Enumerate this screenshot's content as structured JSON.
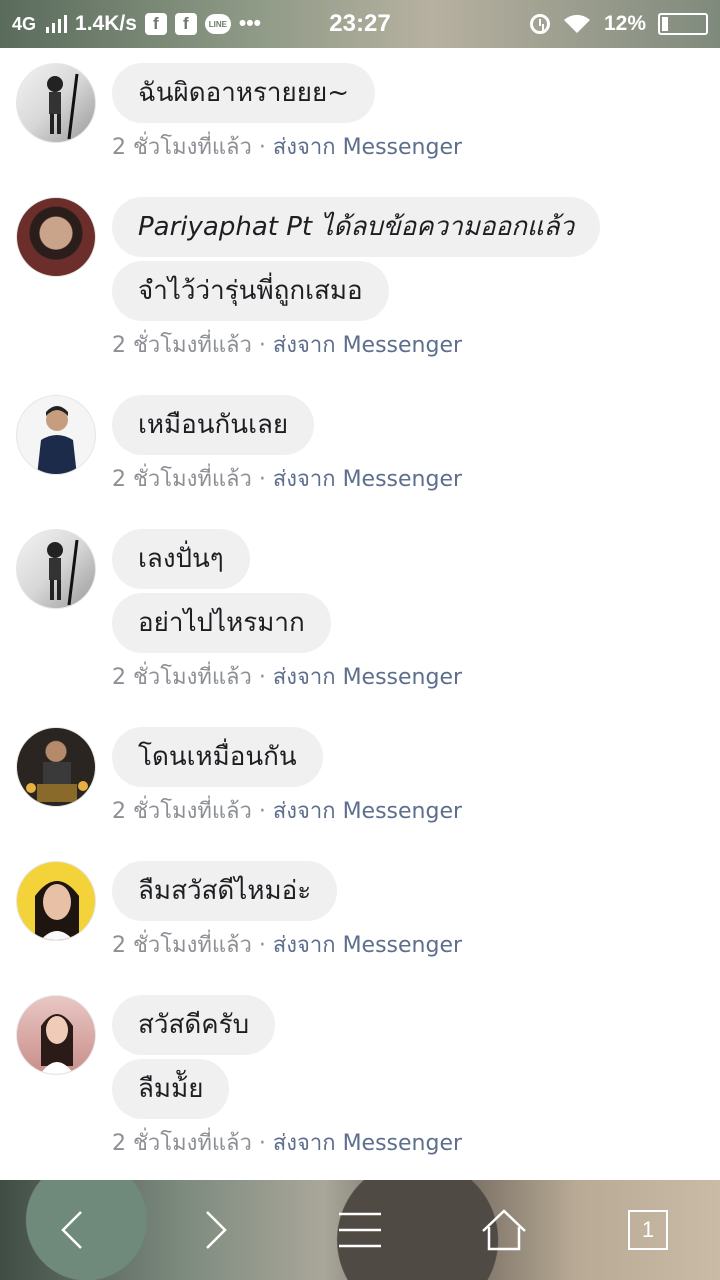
{
  "status_bar": {
    "network": "4G",
    "speed": "1.4K/s",
    "app_icon_1": "f",
    "app_icon_2": "f",
    "line_icon": "LINE",
    "more": "•••",
    "time": "23:27",
    "battery": "12%"
  },
  "comments": [
    {
      "avatar": "avatar-bw-selfie",
      "lines": [
        [
          "ฉันผิดอาหรายยย~"
        ]
      ],
      "time": "2 ชั่วโมงที่แล้ว",
      "separator": " · ",
      "source": "ส่งจาก Messenger"
    },
    {
      "avatar": "avatar-boy-red",
      "lines": [
        [
          "Pariyaphat Pt",
          " ได้ลบข้อความออกแล้ว"
        ],
        [
          "จำไว้ว่ารุ่นพี่ถูกเสมอ"
        ]
      ],
      "time": "2 ชั่วโมงที่แล้ว",
      "separator": " · ",
      "source": "ส่งจาก Messenger"
    },
    {
      "avatar": "avatar-boy-navy",
      "lines": [
        [
          "เหมือนกันเลย"
        ]
      ],
      "time": "2 ชั่วโมงที่แล้ว",
      "separator": " · ",
      "source": "ส่งจาก Messenger"
    },
    {
      "avatar": "avatar-bw-selfie",
      "lines": [
        [
          "เลงปั่นๆ"
        ],
        [
          "อย่าไปไหรมาก"
        ]
      ],
      "time": "2 ชั่วโมงที่แล้ว",
      "separator": " · ",
      "source": "ส่งจาก Messenger"
    },
    {
      "avatar": "avatar-seated",
      "lines": [
        [
          "โดนเหมื่อนกัน"
        ]
      ],
      "time": "2 ชั่วโมงที่แล้ว",
      "separator": " · ",
      "source": "ส่งจาก Messenger"
    },
    {
      "avatar": "avatar-girl-yellow",
      "lines": [
        [
          "ลืมสวัสดีไหมอ่ะ"
        ]
      ],
      "time": "2 ชั่วโมงที่แล้ว",
      "separator": " · ",
      "source": "ส่งจาก Messenger"
    },
    {
      "avatar": "avatar-girl-pink",
      "lines": [
        [
          "สวัสดีครับ"
        ],
        [
          "ลืมม้ัย"
        ]
      ],
      "time": "2 ชั่วโมงที่แล้ว",
      "separator": " · ",
      "source": "ส่งจาก Messenger"
    }
  ],
  "nav": {
    "tab_count": "1"
  },
  "colors": {
    "bubble": "#f0f0f0",
    "meta": "#8c8f94",
    "source": "#5e6f8e"
  }
}
